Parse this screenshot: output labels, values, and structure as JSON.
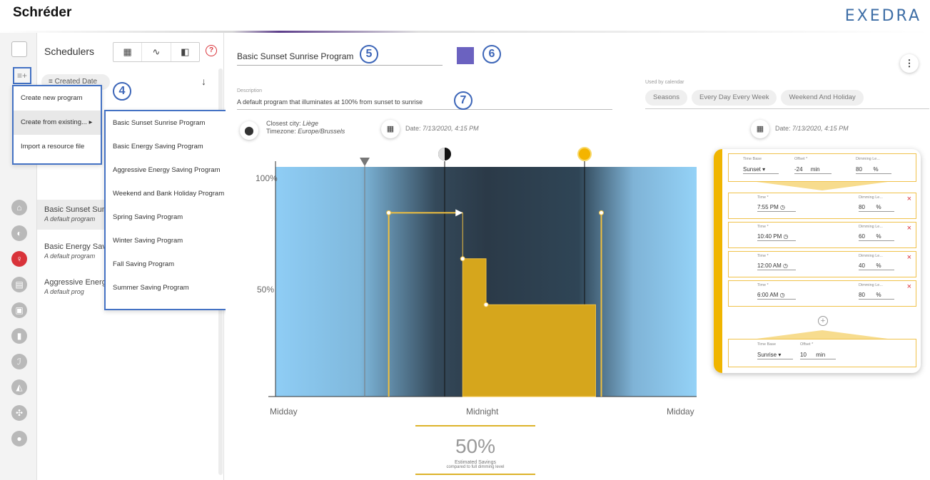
{
  "brand": "Schréder",
  "logo": "EXEDRA",
  "panel": {
    "title": "Schedulers",
    "help_icon": "?",
    "sort_label": "Created Date",
    "sort_arrow": "↓",
    "view_icons": [
      "calendar-icon",
      "chart-icon",
      "map-icon"
    ],
    "add_icon": "≡+"
  },
  "rail_icons": [
    "home-icon",
    "light-icon",
    "bulb-icon",
    "schedule-icon",
    "monitor-icon",
    "battery-icon",
    "wrench-icon",
    "lamp-icon",
    "network-icon",
    "user-icon"
  ],
  "menu": {
    "items": [
      "Create new program",
      "Create from existing...",
      "Import a resource file"
    ],
    "submenu_arrow": "▸"
  },
  "submenu": {
    "items": [
      "Basic Sunset Sunrise Program",
      "Basic Energy Saving Program",
      "Aggressive Energy Saving Program",
      "Weekend and Bank Holiday Program",
      "Spring Saving Program",
      "Winter Saving Program",
      "Fall Saving Program",
      "Summer Saving Program"
    ]
  },
  "programs": [
    {
      "name": "Basic Sunset Sunrise Program",
      "sub": "A default program"
    },
    {
      "name": "Basic Energy Saving Program",
      "sub": "A default program"
    },
    {
      "name": "Aggressive Energy Saving Program",
      "sub": "A default prog"
    }
  ],
  "callouts": {
    "c4": "4",
    "c5": "5",
    "c6": "6",
    "c7": "7"
  },
  "editor": {
    "name": "Basic Sunset Sunrise Program",
    "color": "#6b62c0",
    "more_icon": "⋮",
    "description_label": "Description",
    "description": "A default program that illuminates at 100% from sunset to sunrise",
    "used_by_label": "Used by calendar",
    "calendars": [
      "Seasons",
      "Every Day Every Week",
      "Weekend And Holiday"
    ],
    "closest_city_label": "Closest city:",
    "closest_city": "Liège",
    "timezone_label": "Timezone:",
    "timezone": "Europe/Brussels",
    "date_label": "Date:",
    "date": "7/13/2020, 4:15 PM"
  },
  "chart_data": {
    "type": "area",
    "x_ticks": [
      "Midday",
      "Midnight",
      "Midday"
    ],
    "y_ticks": [
      "100%",
      "50%"
    ],
    "ylim": [
      0,
      100
    ],
    "series": [
      {
        "x": [
          "7:55 PM",
          "10:40 PM",
          "12:00 AM",
          "6:00 AM"
        ],
        "values": [
          80,
          60,
          40,
          80
        ]
      }
    ],
    "sunset": "Sunset -24 min",
    "sunrise": "Sunrise 10 min",
    "savings_value": "50%",
    "savings_label1": "Estimated Savings",
    "savings_label2": "compared to full dimming level"
  },
  "card": {
    "start": {
      "base_label": "Time Base",
      "base": "Sunset",
      "offset_label": "Offset *",
      "offset": "-24",
      "offset_unit": "min",
      "dim_label": "Dimming Le...",
      "dim": "80",
      "dim_unit": "%"
    },
    "steps": [
      {
        "time_label": "Time *",
        "time": "7:55 PM",
        "dim_label": "Dimming Le...",
        "dim": "80",
        "unit": "%"
      },
      {
        "time_label": "Time *",
        "time": "10:40 PM",
        "dim_label": "Dimming Le...",
        "dim": "60",
        "unit": "%"
      },
      {
        "time_label": "Time *",
        "time": "12:00 AM",
        "dim_label": "Dimming Le...",
        "dim": "40",
        "unit": "%"
      },
      {
        "time_label": "Time *",
        "time": "6:00 AM",
        "dim_label": "Dimming Le...",
        "dim": "80",
        "unit": "%"
      }
    ],
    "end": {
      "base_label": "Time Base",
      "base": "Sunrise",
      "offset_label": "Offset *",
      "offset": "10",
      "offset_unit": "min"
    },
    "add_icon": "+",
    "delete_icon": "×"
  }
}
